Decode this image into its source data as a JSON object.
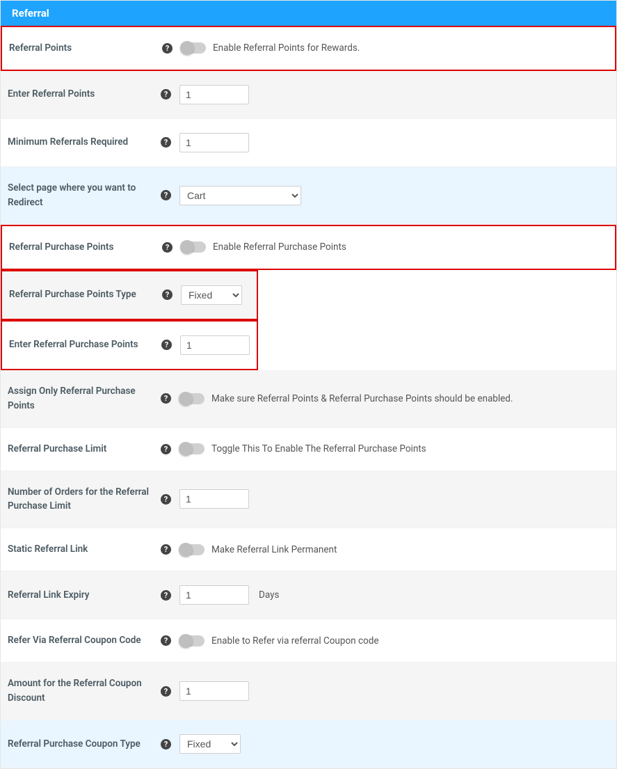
{
  "panel": {
    "title": "Referral"
  },
  "rows": {
    "referralPoints": {
      "label": "Referral Points",
      "desc": "Enable Referral Points for Rewards."
    },
    "enterReferralPoints": {
      "label": "Enter Referral Points",
      "value": "1"
    },
    "minReferrals": {
      "label": "Minimum Referrals Required",
      "value": "1"
    },
    "redirectPage": {
      "label": "Select page where you want to Redirect",
      "value": "Cart"
    },
    "refPurchasePoints": {
      "label": "Referral Purchase Points",
      "desc": "Enable Referral Purchase Points"
    },
    "refPurchaseType": {
      "label": "Referral Purchase Points Type",
      "value": "Fixed"
    },
    "enterRefPurchase": {
      "label": "Enter Referral Purchase Points",
      "value": "1"
    },
    "assignOnly": {
      "label": "Assign Only Referral Purchase Points",
      "desc": "Make sure Referral Points & Referral Purchase Points should be enabled."
    },
    "refPurchaseLimit": {
      "label": "Referral Purchase Limit",
      "desc": "Toggle This To Enable The Referral Purchase Points"
    },
    "ordersForLimit": {
      "label": "Number of Orders for the Referral Purchase Limit",
      "value": "1"
    },
    "staticLink": {
      "label": "Static Referral Link",
      "desc": "Make Referral Link Permanent"
    },
    "linkExpiry": {
      "label": "Referral Link Expiry",
      "value": "1",
      "unit": "Days"
    },
    "referViaCoupon": {
      "label": "Refer Via Referral Coupon Code",
      "desc": "Enable to Refer via referral Coupon code"
    },
    "couponAmount": {
      "label": "Amount for the Referral Coupon Discount",
      "value": "1"
    },
    "couponType": {
      "label": "Referral Purchase Coupon Type",
      "value": "Fixed"
    }
  }
}
